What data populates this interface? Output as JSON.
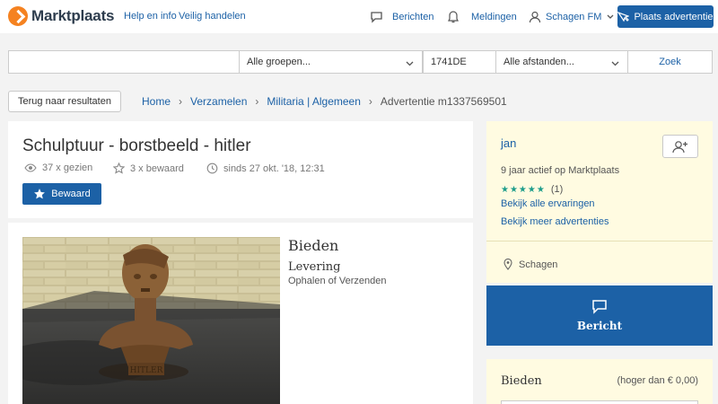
{
  "header": {
    "logo_text": "Marktplaats",
    "links": [
      "Help en info",
      "Veilig handelen"
    ],
    "berichten": "Berichten",
    "meldingen": "Meldingen",
    "account": "Schagen FM",
    "place_ad": "Plaats advertentie"
  },
  "search": {
    "query": "",
    "group": "Alle groepen...",
    "postcode": "1741DE",
    "distance": "Alle afstanden...",
    "button": "Zoek"
  },
  "nav": {
    "back": "Terug naar resultaten",
    "breadcrumbs": [
      "Home",
      "Verzamelen",
      "Militaria | Algemeen",
      "Advertentie m1337569501"
    ]
  },
  "listing": {
    "title": "Schulptuur - borstbeeld - hitler",
    "views": "37 x gezien",
    "saved_count": "3 x bewaard",
    "since": "sinds 27 okt. '18, 12:31",
    "save_button": "Bewaard",
    "price_label": "Bieden",
    "delivery_label": "Levering",
    "delivery_value": "Ophalen of Verzenden",
    "photo_caption": "HITLER"
  },
  "seller": {
    "name": "jan",
    "active": "9 jaar actief op Marktplaats",
    "rating": "★★★★★",
    "rating_count": "(1)",
    "reviews_link": "Bekijk alle ervaringen",
    "more_ads_link": "Bekijk meer advertenties",
    "location": "Schagen"
  },
  "contact": {
    "message_button": "Bericht"
  },
  "bidding": {
    "title": "Bieden",
    "minimum": "(hoger dan € 0,00)"
  },
  "colors": {
    "brand_blue": "#1c61a6",
    "logo_orange": "#f58220",
    "seller_bg": "#fffbe1",
    "star_green": "#1e9d8b"
  }
}
